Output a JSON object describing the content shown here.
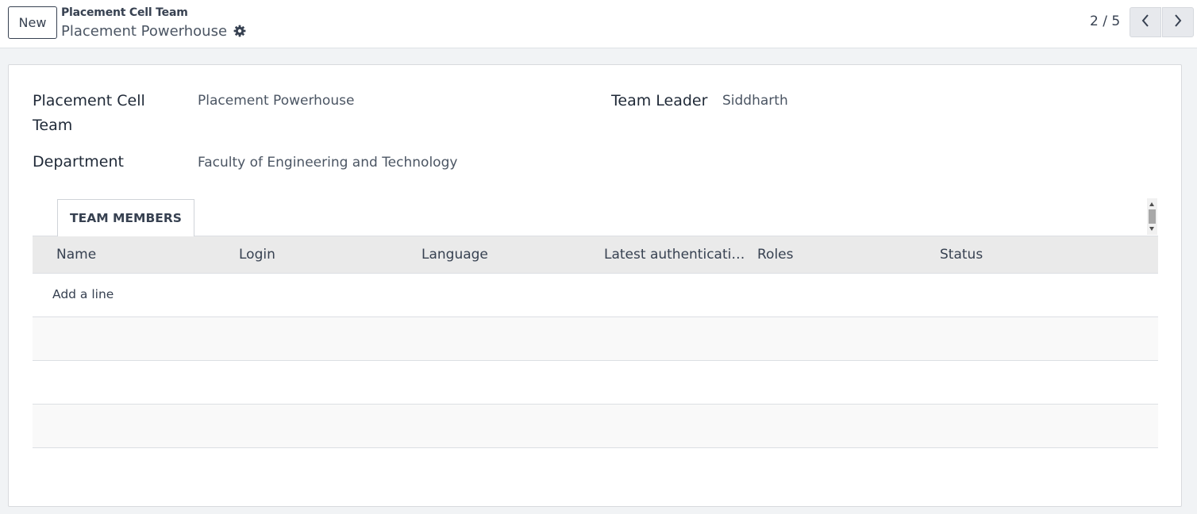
{
  "control_panel": {
    "new_label": "New",
    "breadcrumb_parent": "Placement Cell Team",
    "breadcrumb_current": "Placement Powerhouse",
    "pager_value": "2 / 5"
  },
  "form": {
    "name_label": "Placement Cell Team",
    "name_value": "Placement Powerhouse",
    "department_label": "Department",
    "department_value": "Faculty of Engineering and Technology",
    "leader_label": "Team Leader",
    "leader_value": "Siddharth"
  },
  "notebook": {
    "tab_label": "TEAM MEMBERS",
    "columns": [
      "Name",
      "Login",
      "Language",
      "Latest authentication",
      "Roles",
      "Status"
    ],
    "add_line_label": "Add a line"
  },
  "icons": {
    "gear": "gear-icon",
    "prev": "chevron-left-icon",
    "next": "chevron-right-icon"
  }
}
